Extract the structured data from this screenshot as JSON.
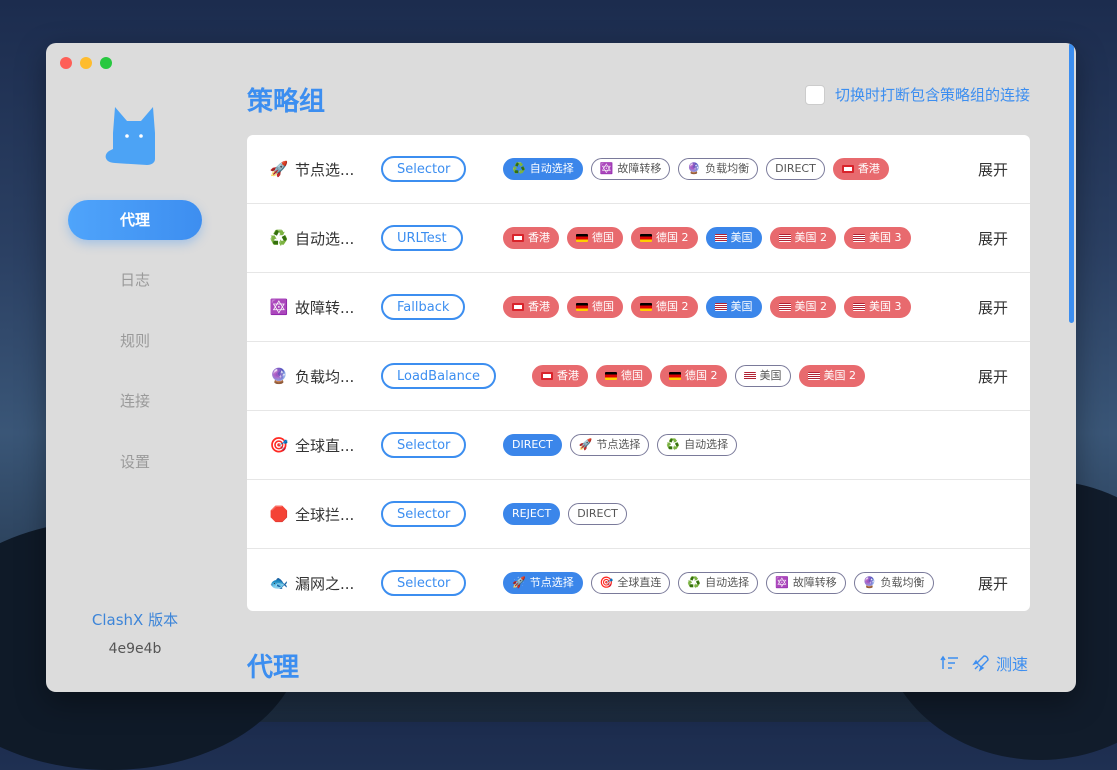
{
  "window": {
    "traffic": [
      "#fe5f57",
      "#febc2e",
      "#28c840"
    ]
  },
  "sidebar": {
    "items": [
      {
        "label": "代理",
        "active": true
      },
      {
        "label": "日志",
        "active": false
      },
      {
        "label": "规则",
        "active": false
      },
      {
        "label": "连接",
        "active": false
      },
      {
        "label": "设置",
        "active": false
      }
    ],
    "version_label": "ClashX 版本",
    "version_value": "4e9e4b"
  },
  "policy": {
    "title": "策略组",
    "toggle_label": "切换时打断包含策略组的连接",
    "rows": [
      {
        "icon": "🚀",
        "name": "节点选...",
        "type": "Selector",
        "expand": "展开",
        "chips": [
          {
            "text": "自动选择",
            "icon": "♻️",
            "style": "blue"
          },
          {
            "text": "故障转移",
            "icon": "🔯",
            "style": "out"
          },
          {
            "text": "负载均衡",
            "icon": "🔮",
            "style": "out"
          },
          {
            "text": "DIRECT",
            "icon": "",
            "style": "out"
          },
          {
            "text": "香港",
            "icon": "hk",
            "style": "red"
          }
        ]
      },
      {
        "icon": "♻️",
        "name": "自动选...",
        "type": "URLTest",
        "expand": "展开",
        "chips": [
          {
            "text": "香港",
            "icon": "hk",
            "style": "red"
          },
          {
            "text": "德国",
            "icon": "de",
            "style": "red"
          },
          {
            "text": "德国 2",
            "icon": "de",
            "style": "red"
          },
          {
            "text": "美国",
            "icon": "us",
            "style": "blue"
          },
          {
            "text": "美国 2",
            "icon": "us",
            "style": "red"
          },
          {
            "text": "美国 3",
            "icon": "us",
            "style": "red"
          }
        ]
      },
      {
        "icon": "🔯",
        "name": "故障转...",
        "type": "Fallback",
        "expand": "展开",
        "chips": [
          {
            "text": "香港",
            "icon": "hk",
            "style": "red"
          },
          {
            "text": "德国",
            "icon": "de",
            "style": "red"
          },
          {
            "text": "德国 2",
            "icon": "de",
            "style": "red"
          },
          {
            "text": "美国",
            "icon": "us",
            "style": "blue"
          },
          {
            "text": "美国 2",
            "icon": "us",
            "style": "red"
          },
          {
            "text": "美国 3",
            "icon": "us",
            "style": "red"
          }
        ]
      },
      {
        "icon": "🔮",
        "name": "负载均...",
        "type": "LoadBalance",
        "expand": "展开",
        "chips": [
          {
            "text": "香港",
            "icon": "hk",
            "style": "red"
          },
          {
            "text": "德国",
            "icon": "de",
            "style": "red"
          },
          {
            "text": "德国 2",
            "icon": "de",
            "style": "red"
          },
          {
            "text": "美国",
            "icon": "us",
            "style": "out"
          },
          {
            "text": "美国 2",
            "icon": "us",
            "style": "red"
          }
        ]
      },
      {
        "icon": "🎯",
        "name": "全球直...",
        "type": "Selector",
        "expand": "",
        "chips": [
          {
            "text": "DIRECT",
            "icon": "",
            "style": "blue"
          },
          {
            "text": "节点选择",
            "icon": "🚀",
            "style": "out"
          },
          {
            "text": "自动选择",
            "icon": "♻️",
            "style": "out"
          }
        ]
      },
      {
        "icon": "🛑",
        "name": "全球拦...",
        "type": "Selector",
        "expand": "",
        "chips": [
          {
            "text": "REJECT",
            "icon": "",
            "style": "blue"
          },
          {
            "text": "DIRECT",
            "icon": "",
            "style": "out"
          }
        ]
      },
      {
        "icon": "🐟",
        "name": "漏网之...",
        "type": "Selector",
        "expand": "展开",
        "chips": [
          {
            "text": "节点选择",
            "icon": "🚀",
            "style": "blue"
          },
          {
            "text": "全球直连",
            "icon": "🎯",
            "style": "out"
          },
          {
            "text": "自动选择",
            "icon": "♻️",
            "style": "out"
          },
          {
            "text": "故障转移",
            "icon": "🔯",
            "style": "out"
          },
          {
            "text": "负载均衡",
            "icon": "🔮",
            "style": "out"
          }
        ]
      }
    ]
  },
  "proxies": {
    "title": "代理",
    "speed_label": "测速"
  },
  "colors": {
    "accent": "#3c8ef0",
    "chip_red": "#e86a6e",
    "chip_blue": "#3b86ea"
  }
}
